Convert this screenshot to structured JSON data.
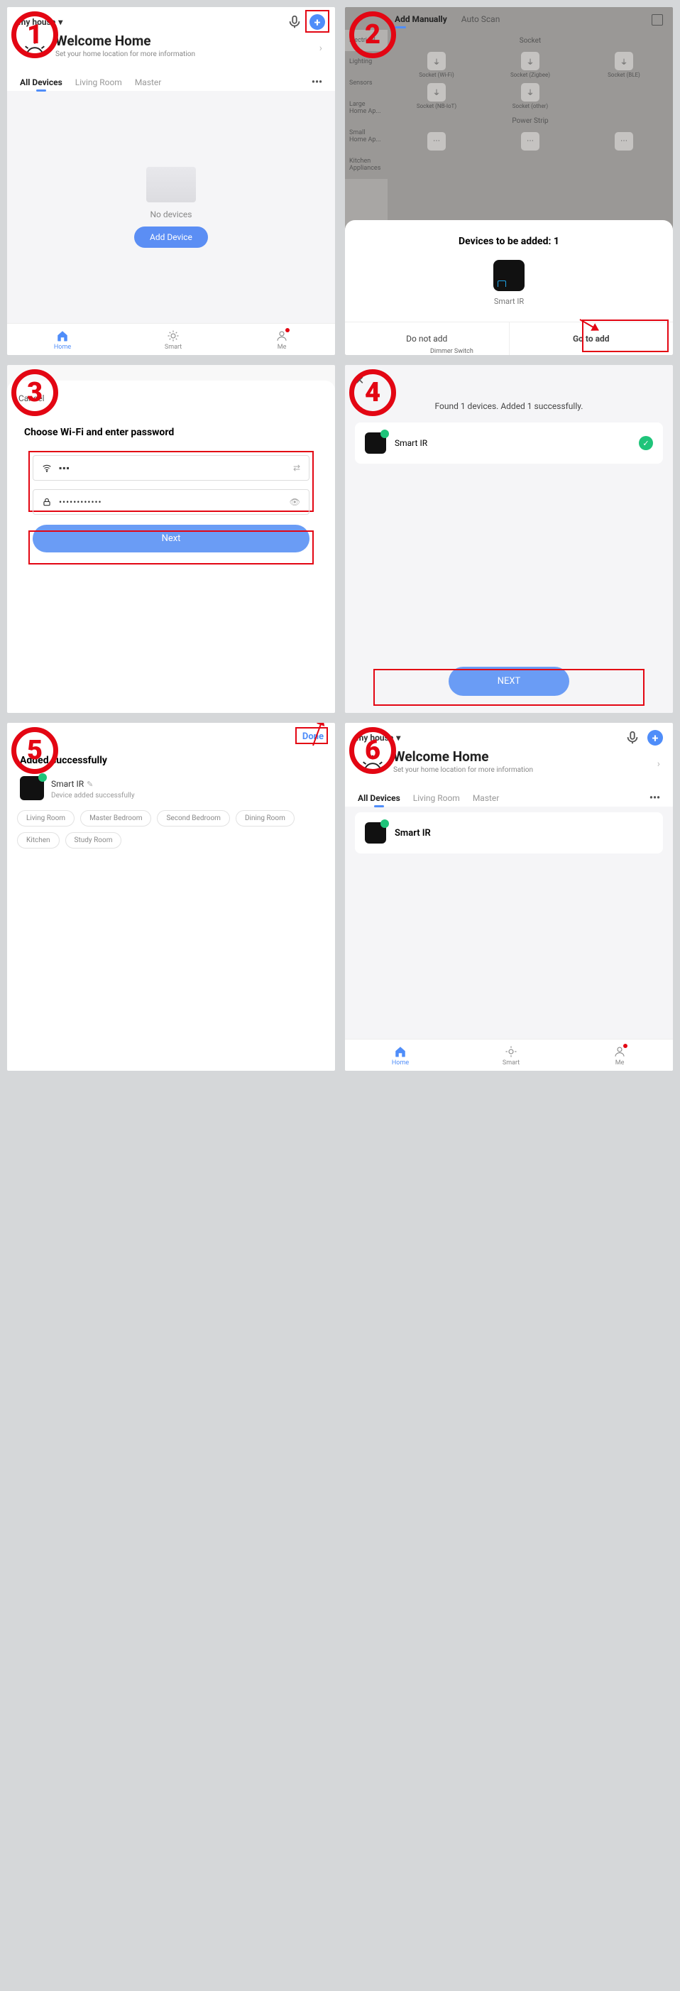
{
  "steps": [
    "1",
    "2",
    "3",
    "4",
    "5",
    "6"
  ],
  "s1": {
    "house": "my house",
    "title": "Welcome Home",
    "sub": "Set your home location for more information",
    "tabs": [
      "All Devices",
      "Living Room",
      "Master"
    ],
    "empty": "No devices",
    "add": "Add Device",
    "nav": [
      "Home",
      "Smart",
      "Me"
    ]
  },
  "s2": {
    "tabs": [
      "Add Manually",
      "Auto Scan"
    ],
    "cats": [
      "Electrical",
      "Lighting",
      "Sensors",
      "Large Home Ap...",
      "Small Home Ap...",
      "Kitchen Appliances"
    ],
    "section1": "Socket",
    "items1": [
      "Socket (Wi-Fi)",
      "Socket (Zigbee)",
      "Socket (BLE)",
      "Socket (NB-IoT)",
      "Socket (other)"
    ],
    "section2": "Power Strip",
    "sheet_title": "Devices to be added: 1",
    "device": "Smart IR",
    "btn_no": "Do not add",
    "btn_go": "Go to add",
    "dimmer": "Dimmer Switch"
  },
  "s3": {
    "cancel": "Cancel",
    "title": "Choose Wi-Fi and enter password",
    "ssid": "▪▪▪",
    "pwd": "••••••••••••",
    "next": "Next"
  },
  "s4": {
    "close": "✕",
    "msg": "Found 1 devices. Added 1 successfully.",
    "device": "Smart IR",
    "next": "NEXT"
  },
  "s5": {
    "done": "Done",
    "title": "Added successfully",
    "device": "Smart IR",
    "sub": "Device added successfully",
    "rooms": [
      "Living Room",
      "Master Bedroom",
      "Second Bedroom",
      "Dining Room",
      "Kitchen",
      "Study Room"
    ]
  },
  "s6": {
    "house": "my house",
    "title": "Welcome Home",
    "sub": "Set your home location for more information",
    "tabs": [
      "All Devices",
      "Living Room",
      "Master"
    ],
    "device": "Smart IR",
    "nav": [
      "Home",
      "Smart",
      "Me"
    ]
  }
}
